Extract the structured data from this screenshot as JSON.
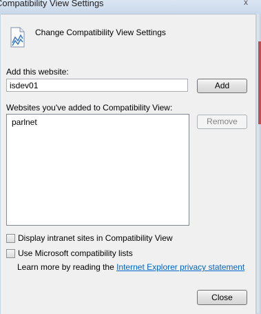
{
  "window": {
    "title": "Compatibility View Settings",
    "close_glyph": "x"
  },
  "header": {
    "icon": "compatibility-view-icon",
    "text": "Change Compatibility View Settings"
  },
  "add_site": {
    "label": "Add this website:",
    "value": "isdev01",
    "button": "Add"
  },
  "sites_list": {
    "label": "Websites you've added to Compatibility View:",
    "items": [
      "parlnet"
    ],
    "remove_button": "Remove"
  },
  "options": {
    "intranet_label": "Display intranet sites in Compatibility View",
    "intranet_checked": false,
    "ms_lists_label": "Use Microsoft compatibility lists",
    "ms_lists_checked": false
  },
  "learn_more": {
    "prefix": "Learn more by reading the ",
    "link": "Internet Explorer privacy statement"
  },
  "footer": {
    "close_button": "Close"
  }
}
